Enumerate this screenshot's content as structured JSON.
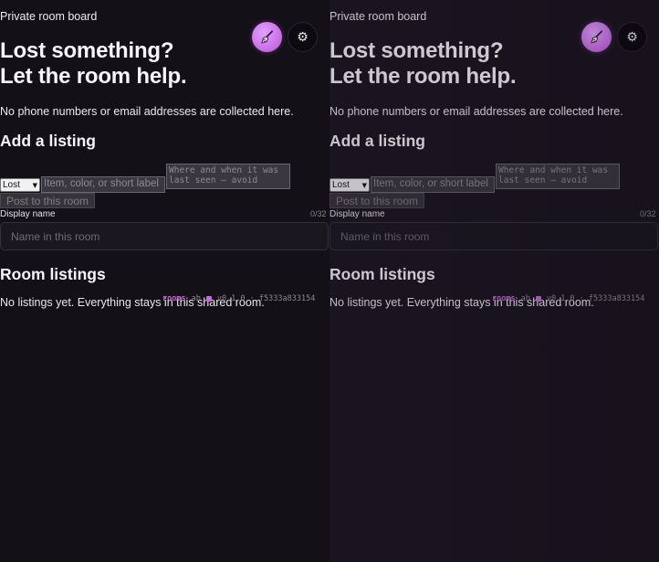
{
  "header": {
    "label": "Private room board"
  },
  "icons": {
    "avatar": "broom-icon",
    "settings": "gear-icon",
    "accent": "#c86ae6"
  },
  "hero": {
    "line1": "Lost something?",
    "line2": "Let the room help."
  },
  "privacy_note": "No phone numbers or email addresses are collected here.",
  "add_listing": {
    "heading": "Add a listing",
    "type_selected": "Lost",
    "item_placeholder": "Item, color, or short label",
    "where_placeholder": "Where and when it was last seen — avoid",
    "post_label": "Post to this room",
    "display_name_label": "Display name",
    "display_name_counter": "0/32",
    "display_name_placeholder": "Name in this room"
  },
  "room_listings": {
    "heading": "Room listings",
    "empty_text": "No listings yet. Everything stays in this shared room."
  },
  "footer_meta": {
    "tag": "rooms",
    "small": "ab",
    "version": "v0.1.0 · f5333a833154"
  }
}
